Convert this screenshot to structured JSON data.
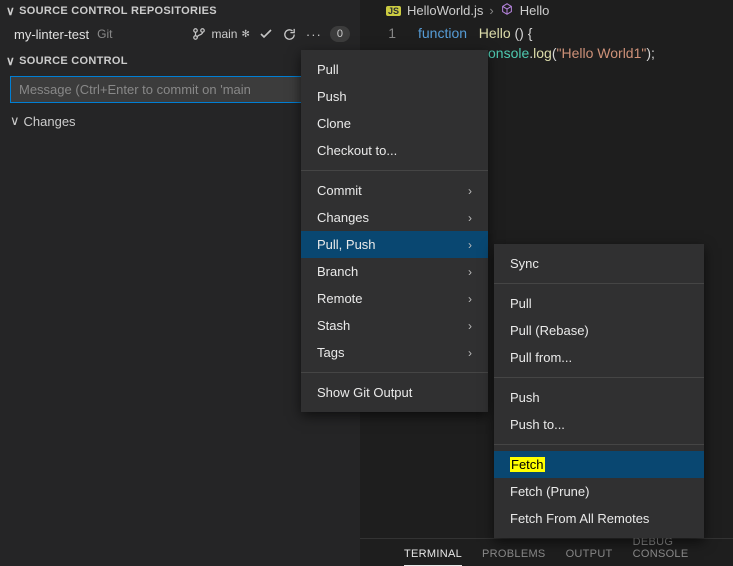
{
  "sidebar": {
    "repos_header": "SOURCE CONTROL REPOSITORIES",
    "repo": {
      "name": "my-linter-test",
      "type": "Git"
    },
    "branch": {
      "name": "main"
    },
    "count_badge": "0",
    "scm_header": "SOURCE CONTROL",
    "commit_placeholder": "Message (Ctrl+Enter to commit on 'main",
    "changes_label": "Changes"
  },
  "breadcrumb": {
    "file": "HelloWorld.js",
    "symbol": "Hello"
  },
  "code": {
    "line1_no": "1",
    "kw_function": "function",
    "fn_name": "Hello",
    "paren_open": "() {",
    "obj": "onsole",
    "dot": ".",
    "method": "log",
    "open": "(",
    "str": "\"Hello World1\"",
    "close": ");"
  },
  "bottom_tabs": {
    "terminal": "TERMINAL",
    "problems": "PROBLEMS",
    "output": "OUTPUT",
    "debug": "DEBUG CONSOLE"
  },
  "menu1": {
    "pull": "Pull",
    "push": "Push",
    "clone": "Clone",
    "checkout": "Checkout to...",
    "commit": "Commit",
    "changes": "Changes",
    "pull_push": "Pull, Push",
    "branch": "Branch",
    "remote": "Remote",
    "stash": "Stash",
    "tags": "Tags",
    "show_output": "Show Git Output"
  },
  "menu2": {
    "sync": "Sync",
    "pull": "Pull",
    "pull_rebase": "Pull (Rebase)",
    "pull_from": "Pull from...",
    "push": "Push",
    "push_to": "Push to...",
    "fetch": "Fetch",
    "fetch_prune": "Fetch (Prune)",
    "fetch_all": "Fetch From All Remotes"
  }
}
